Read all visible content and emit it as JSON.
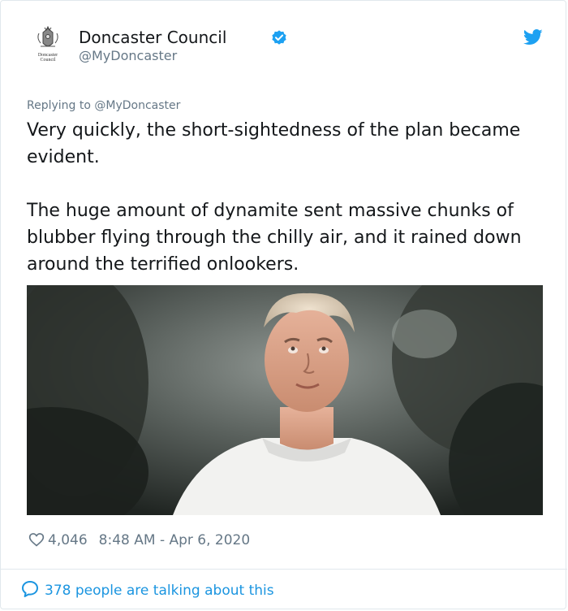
{
  "tweet": {
    "author_name": "Doncaster Council",
    "author_handle": "@MyDoncaster",
    "avatar_text": [
      "Doncaster",
      "Council"
    ],
    "replying_to_prefix": "Replying to ",
    "replying_to_handle": "@MyDoncaster",
    "paragraphs": [
      "Very quickly, the short-sightedness of the plan became evident.",
      "The huge amount of dynamite sent massive chunks of blubber flying through the chilly air, and it rained down around the terrified onlookers."
    ],
    "like_count": "4,046",
    "timestamp": "8:48 AM - Apr 6, 2020",
    "talking_text": "378 people are talking about this"
  },
  "icons": {
    "verified": "verified-badge-icon",
    "twitter": "twitter-bird-icon",
    "like": "heart-icon",
    "conversation": "speech-bubble-icon"
  },
  "colors": {
    "accent": "#1da1f2",
    "link": "#1b95e0",
    "text": "#14171a",
    "muted": "#657786",
    "border": "#e1e8ed"
  }
}
